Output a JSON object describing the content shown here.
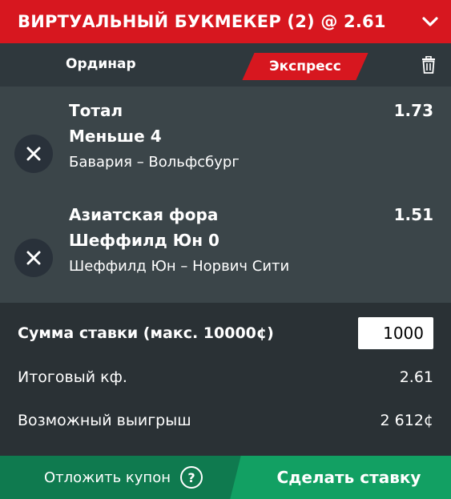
{
  "header": {
    "title": "ВИРТУАЛЬНЫЙ БУКМЕКЕР (2) @ 2.61"
  },
  "tabs": {
    "single": "Ординар",
    "express": "Экспресс",
    "active": "express"
  },
  "bets": [
    {
      "market": "Тотал",
      "selection": "Меньше 4",
      "match": "Бавария – Вольфсбург",
      "odds": "1.73"
    },
    {
      "market": "Азиатская фора",
      "selection": "Шеффилд Юн 0",
      "match": "Шеффилд Юн – Норвич Сити",
      "odds": "1.51"
    }
  ],
  "summary": {
    "stake_label": "Сумма ставки (макс. 10000¢)",
    "stake_value": "1000",
    "total_odds_label": "Итоговый кф.",
    "total_odds_value": "2.61",
    "potential_win_label": "Возможный выигрыш",
    "potential_win_value": "2 612¢"
  },
  "footer": {
    "defer_label": "Отложить купон",
    "help_glyph": "?",
    "place_label": "Сделать ставку"
  },
  "colors": {
    "header_red": "#d7171f",
    "bet_bg": "#3b4549",
    "panel_bg": "#2a3135",
    "green_dark": "#0f7a4f",
    "green_light": "#12a063"
  },
  "icons": {
    "collapse": "chevron-down-icon",
    "trash": "trash-icon",
    "remove": "close-icon",
    "help": "question-icon"
  }
}
